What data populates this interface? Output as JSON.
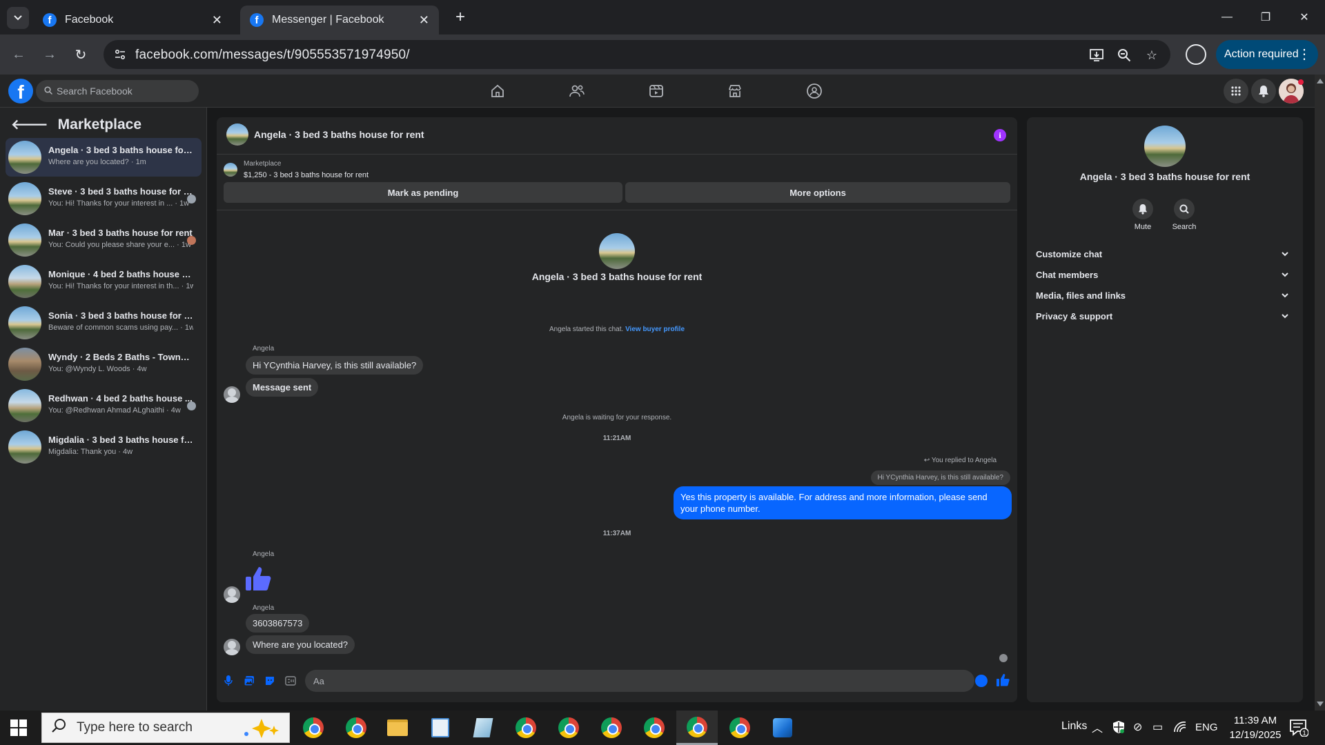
{
  "browser": {
    "tabs": [
      {
        "title": "Facebook",
        "active": false
      },
      {
        "title": "Messenger | Facebook",
        "active": true
      }
    ],
    "url": "facebook.com/messages/t/905553571974950/",
    "action_label": "Action required"
  },
  "fb": {
    "search_placeholder": "Search Facebook"
  },
  "left": {
    "title": "Marketplace",
    "conversations": [
      {
        "name": "Angela · 3 bed 3 baths house for r...",
        "snippet": "Where are you located? · 1m",
        "selected": true
      },
      {
        "name": "Steve · 3 bed 3 baths house for r...",
        "snippet": "You: Hi! Thanks for your interest in ... · 1w"
      },
      {
        "name": "Mar · 3 bed 3 baths house for rent",
        "snippet": "You: Could you please share your e... · 1w"
      },
      {
        "name": "Monique · 4 bed 2 baths house for...",
        "snippet": "You: Hi! Thanks for your interest in th... · 1w"
      },
      {
        "name": "Sonia · 3 bed 3 baths house for rent",
        "snippet": "Beware of common scams using pay... · 1w"
      },
      {
        "name": "Wyndy · 2 Beds 2 Baths - Townhou...",
        "snippet": "You: @Wyndy L. Woods · 4w"
      },
      {
        "name": "Redhwan · 4 bed 2 baths house ...",
        "snippet": "You: @Redhwan Ahmad ALghaithi · 4w"
      },
      {
        "name": "Migdalia · 3 bed 3 baths house for...",
        "snippet": "Migdalia: Thank you · 4w"
      }
    ]
  },
  "chat": {
    "title": "Angela · 3 bed 3 baths house for rent",
    "marketplace_label": "Marketplace",
    "listing": "$1,250 - 3 bed 3 baths house for rent",
    "mark_pending": "Mark as pending",
    "more_options": "More options",
    "center_name": "Angela · 3 bed 3 baths house for rent",
    "started_text": "Angela started this chat.",
    "view_buyer": "View buyer profile",
    "sender": "Angela",
    "msg1": "Hi YCynthia Harvey, is this still available?",
    "msg2": "Message sent",
    "waiting": "Angela is waiting for your response.",
    "time1": "11:21AM",
    "replied_to": "You replied to Angela",
    "quoted": "Hi YCynthia Harvey, is this still available?",
    "my_reply": "Yes this property is available. For address and more information, please send your phone number.",
    "time2": "11:37AM",
    "msg3": "3603867573",
    "msg4": "Where are you located?",
    "composer_placeholder": "Aa"
  },
  "right": {
    "name": "Angela · 3 bed 3 baths house for rent",
    "mute": "Mute",
    "search": "Search",
    "sections": [
      "Customize chat",
      "Chat members",
      "Media, files and links",
      "Privacy & support"
    ]
  },
  "taskbar": {
    "search_placeholder": "Type here to search",
    "links": "Links",
    "lang": "ENG",
    "time": "11:39 AM",
    "date": "12/19/2025",
    "notif_count": "1"
  },
  "colors": {
    "accent": "#0866ff",
    "fb_blue": "#1877f2",
    "info_purple": "#a033ff"
  }
}
